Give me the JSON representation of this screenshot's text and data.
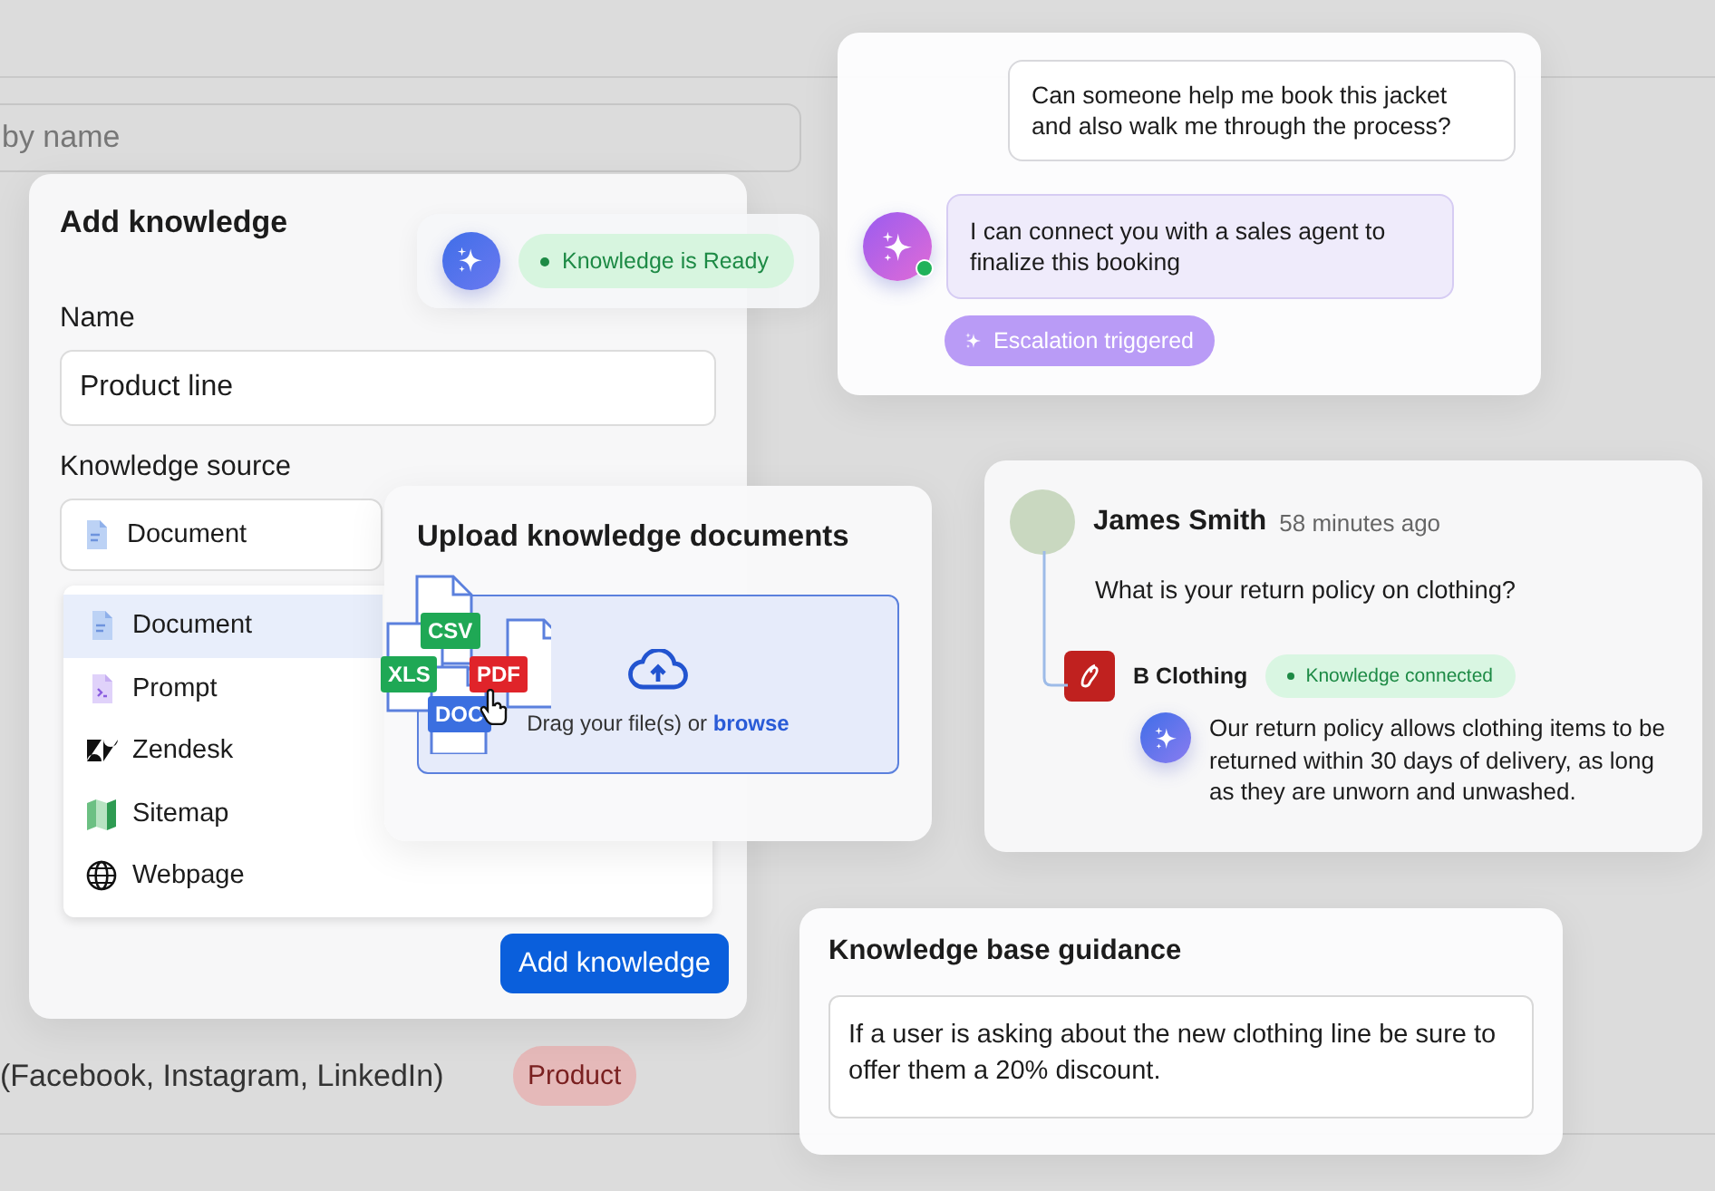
{
  "background": {
    "search": {
      "placeholder": "by name"
    },
    "rows": [
      {
        "name": "(Facebook, Instagram, LinkedIn)",
        "tag": "Product"
      }
    ]
  },
  "add_knowledge": {
    "title": "Add knowledge",
    "name_label": "Name",
    "name_value": "Product line",
    "source_label": "Knowledge source",
    "source_value": "Document",
    "options": [
      {
        "label": "Document",
        "kind": "document",
        "selected": true
      },
      {
        "label": "Prompt",
        "kind": "prompt",
        "selected": false
      },
      {
        "label": "Zendesk",
        "kind": "zendesk",
        "selected": false
      },
      {
        "label": "Sitemap",
        "kind": "map",
        "selected": false
      },
      {
        "label": "Webpage",
        "kind": "globe",
        "selected": false
      }
    ],
    "button": "Add knowledge"
  },
  "toast": {
    "status": "Knowledge is Ready"
  },
  "upload": {
    "title": "Upload knowledge documents",
    "badges": [
      {
        "label": "CSV",
        "color": "#1fa855"
      },
      {
        "label": "XLS",
        "color": "#1fa855"
      },
      {
        "label": "PDF",
        "color": "#e0242a"
      },
      {
        "label": "DOC",
        "color": "#3b6fe0"
      }
    ],
    "prompt": "Drag your file(s) or",
    "link": "browse"
  },
  "chat": {
    "messages": [
      {
        "kind": "user",
        "text": "Can someone help me book this jacket and also walk me through the process?"
      },
      {
        "kind": "bot",
        "text": "I can connect you with a sales agent to finalize this booking",
        "online": true
      }
    ],
    "escalation": "Escalation triggered"
  },
  "thread": {
    "author": "James Smith",
    "time": "58 minutes ago",
    "question": "What is your return policy on clothing?",
    "brand": "B Clothing",
    "status": "Knowledge connected",
    "answer": "Our return policy allows clothing items to be returned within 30 days of delivery, as long as they are unworn and unwashed."
  },
  "guidance": {
    "title": "Knowledge base guidance",
    "value": "If a user is asking about the new clothing line be sure to offer them a 20% discount."
  }
}
